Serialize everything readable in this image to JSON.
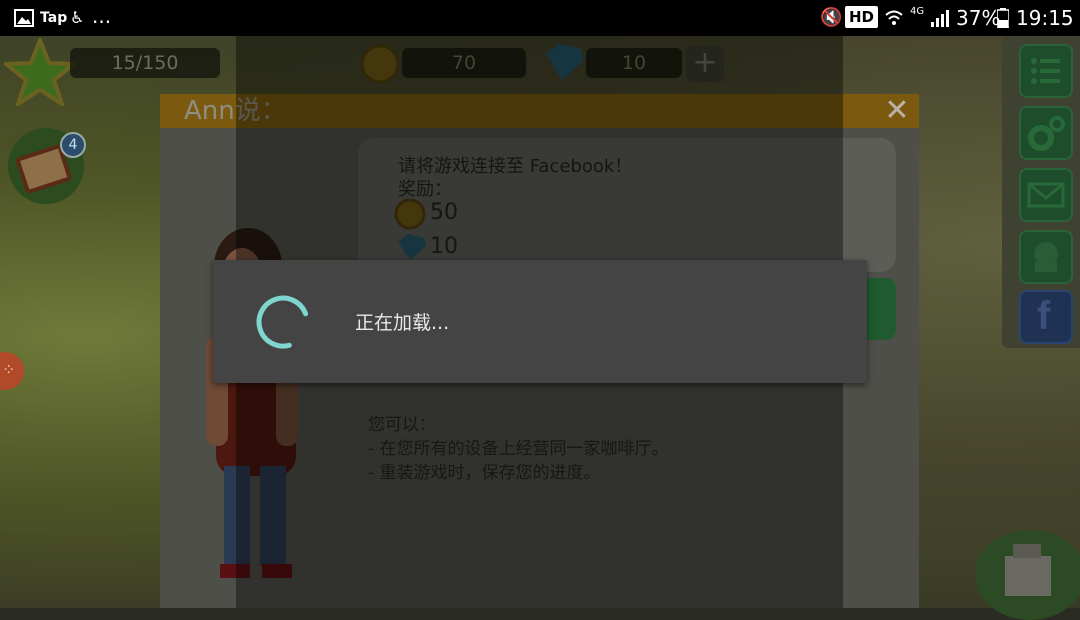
{
  "status_bar": {
    "app_name": "Tap",
    "more": "...",
    "hd_badge": "HD",
    "network": "4G",
    "battery": "37%",
    "time": "19:15"
  },
  "hud": {
    "xp": "15/150",
    "coins": "70",
    "gems": "10",
    "plus": "+",
    "book_badge": "4"
  },
  "dialog": {
    "title": "Ann说：",
    "close": "✕",
    "bubble_line1": "请将游戏连接至 Facebook！",
    "bubble_line2": "奖励：",
    "reward_coins": "50",
    "reward_gems": "10",
    "body_heading": "您可以：",
    "body_item1": "- 在您所有的设备上经营同一家咖啡厅。",
    "body_item2": "- 重装游戏时，保存您的进度。"
  },
  "loading": {
    "text": "正在加载..."
  },
  "side_menu": [
    "list-icon",
    "gear-icon",
    "mail-icon",
    "flower-icon",
    "facebook-icon"
  ],
  "colors": {
    "spinner": "#7fd6cf",
    "dialog_title_bar": "#7b5a10",
    "loading_bg": "#444444"
  }
}
